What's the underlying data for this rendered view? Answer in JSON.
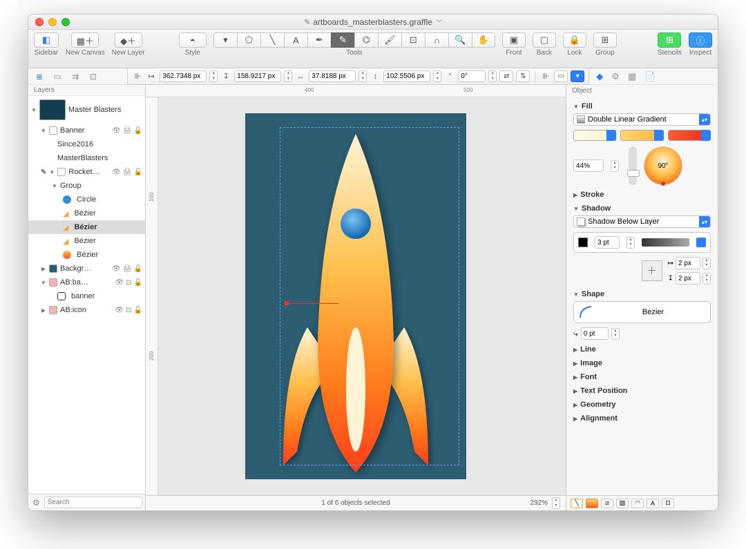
{
  "title": {
    "edited": "Edited",
    "filename": "artboards_masterblasters.graffle"
  },
  "toolbar": {
    "sidebar": "Sidebar",
    "new_canvas": "New Canvas",
    "new_layer": "New Layer",
    "style": "Style",
    "tools": "Tools",
    "front": "Front",
    "back": "Back",
    "lock": "Lock",
    "group": "Group",
    "stencils": "Stencils",
    "inspect": "Inspect"
  },
  "geom": {
    "x": "362.7348 px",
    "y": "158.9217 px",
    "w": "37.8188 px",
    "h": "102.5506 px",
    "angle_prefix": "°",
    "angle": "0°"
  },
  "rulers": {
    "r1": "400",
    "r2": "500"
  },
  "sidebar": {
    "header": "Layers",
    "canvas": "Master Blasters",
    "banner": "Banner",
    "since": "Since2016",
    "mb": "MasterBlasters",
    "rocket": "Rocket…",
    "group": "Group",
    "circle": "Circle",
    "bezier": "Bézier",
    "bezier_sel": "Bézier",
    "bezier3": "Bézier",
    "bezier4": "Bézier",
    "backgr": "Backgr…",
    "abba": "AB:ba…",
    "banner2": "banner",
    "abicon": "AB:icon",
    "search_placeholder": "Search"
  },
  "status": {
    "selection": "1 of 6 objects selected",
    "zoom": "292%"
  },
  "inspector": {
    "header": "Object",
    "fill": "Fill",
    "fill_type": "Double Linear Gradient",
    "blend": "44%",
    "angle": "90°",
    "stroke": "Stroke",
    "shadow": "Shadow",
    "shadow_type": "Shadow Below Layer",
    "shadow_radius": "3 pt",
    "shadow_off_x": "2 px",
    "shadow_off_y": "2 px",
    "shape": "Shape",
    "shape_name": "Bezier",
    "corner": "0 pt",
    "line": "Line",
    "image": "Image",
    "font": "Font",
    "text_position": "Text Position",
    "geometry": "Geometry",
    "alignment": "Alignment"
  }
}
